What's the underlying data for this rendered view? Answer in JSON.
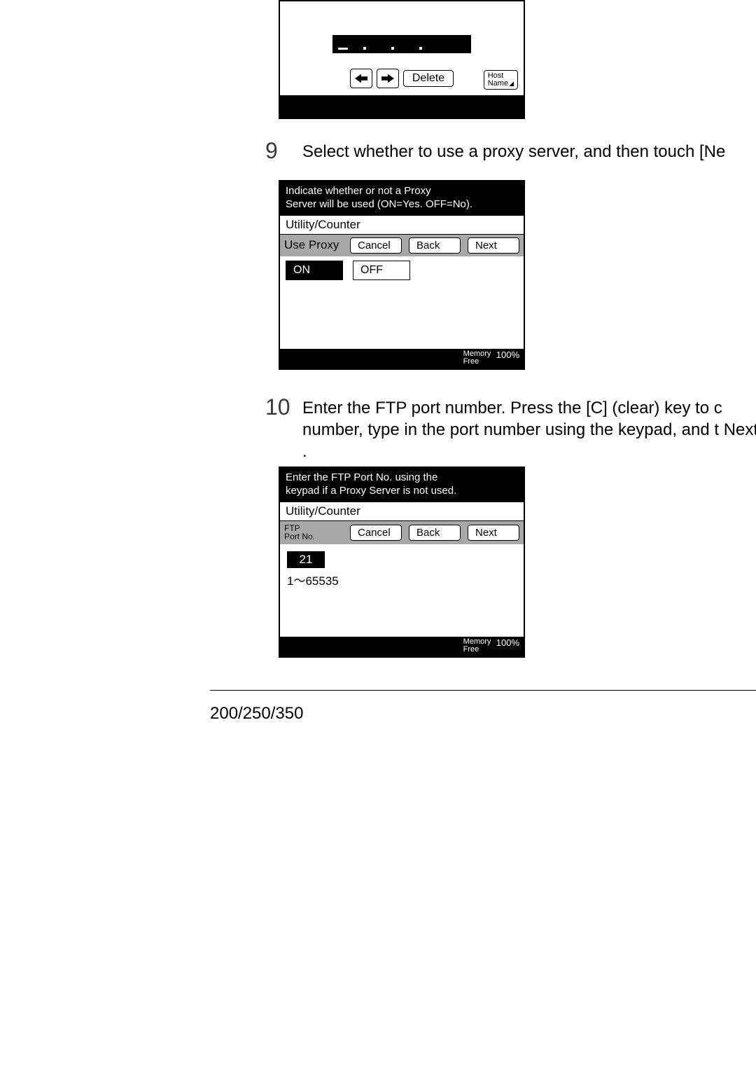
{
  "steps": {
    "s9": {
      "num": "9",
      "text": "Select whether to use a proxy server, and then touch [Ne"
    },
    "s10": {
      "num": "10",
      "text": "Enter the FTP port number. Press the [C] (clear) key to c number, type in the port number using the keypad, and t Next ."
    }
  },
  "top_panel": {
    "input_display": "_   .   .   .",
    "delete_label": "Delete",
    "host_label_line1": "Host",
    "host_label_line2": "Name"
  },
  "proxy_panel": {
    "header_line1": "Indicate whether or not a Proxy",
    "header_line2": "Server will be used (ON=Yes. OFF=No).",
    "mid": "Utility/Counter",
    "label": "Use Proxy",
    "cancel": "Cancel",
    "back": "Back",
    "next": "Next",
    "on": "ON",
    "off": "OFF",
    "mem_line1": "Memory",
    "mem_line2": "Free",
    "pct": "100%"
  },
  "port_panel": {
    "header_line1": "Enter the FTP Port No. using the",
    "header_line2": "keypad if a Proxy Server is not used.",
    "mid": "Utility/Counter",
    "label_line1": "FTP",
    "label_line2": "Port No.",
    "cancel": "Cancel",
    "back": "Back",
    "next": "Next",
    "value": "21",
    "range": "1～65535",
    "mem_line1": "Memory",
    "mem_line2": "Free",
    "pct": "100%"
  },
  "footer": "200/250/350"
}
